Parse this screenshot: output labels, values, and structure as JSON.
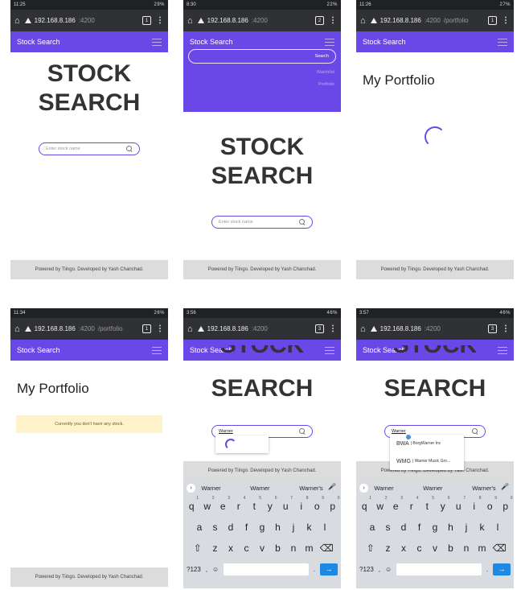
{
  "brand_color": "#6a48e8",
  "common": {
    "nav_title": "Stock Search",
    "footer": "Powered by Tiingo. Developed by Yash Chanchad.",
    "url_host": "192.168.8.186",
    "url_port": ":4200",
    "heading_line1": "STOCK",
    "heading_line2": "SEARCH",
    "search_placeholder": "Enter stock name"
  },
  "screens": [
    {
      "time": "11:25",
      "status_right": "29%",
      "tabs": "1",
      "url_path": ""
    },
    {
      "time": "8:30",
      "status_right": "22%",
      "tabs": "2",
      "url_path": "",
      "menu": {
        "search_btn": "Search",
        "watchlist": "Watchlist",
        "portfolio": "Portfolio"
      }
    },
    {
      "time": "11:26",
      "status_right": "27%",
      "tabs": "1",
      "url_path": "/portfolio",
      "title": "My Portfolio"
    },
    {
      "time": "11:34",
      "status_right": "26%",
      "tabs": "1",
      "url_path": "/portfolio",
      "title": "My Portfolio",
      "alert": "Currently you don't have any stock."
    },
    {
      "time": "3:56",
      "status_right": "46%",
      "tabs": "3",
      "url_path": "",
      "search_value": "Warner"
    },
    {
      "time": "3:57",
      "status_right": "46%",
      "tabs": "3",
      "url_path": "",
      "search_value": "Warner",
      "results": [
        {
          "ticker": "BWA",
          "name": "| BorgWarner Inc"
        },
        {
          "ticker": "WMG",
          "name": "| Warner Music Gro..."
        }
      ]
    }
  ],
  "keyboard": {
    "suggestions": [
      "Warner",
      "Warner",
      "Warner's"
    ],
    "row1": [
      "q",
      "w",
      "e",
      "r",
      "t",
      "y",
      "u",
      "i",
      "o",
      "p"
    ],
    "row1_nums": [
      "1",
      "2",
      "3",
      "4",
      "5",
      "6",
      "7",
      "8",
      "9",
      "0"
    ],
    "row2": [
      "a",
      "s",
      "d",
      "f",
      "g",
      "h",
      "j",
      "k",
      "l"
    ],
    "row3": [
      "z",
      "x",
      "c",
      "v",
      "b",
      "n",
      "m"
    ],
    "symbols": "?123",
    "comma": ",",
    "period": ".",
    "shift": "⇧",
    "backspace": "⌫",
    "enter": "→",
    "emoji": "☺",
    "chevron": "›",
    "mic": "🎤"
  }
}
